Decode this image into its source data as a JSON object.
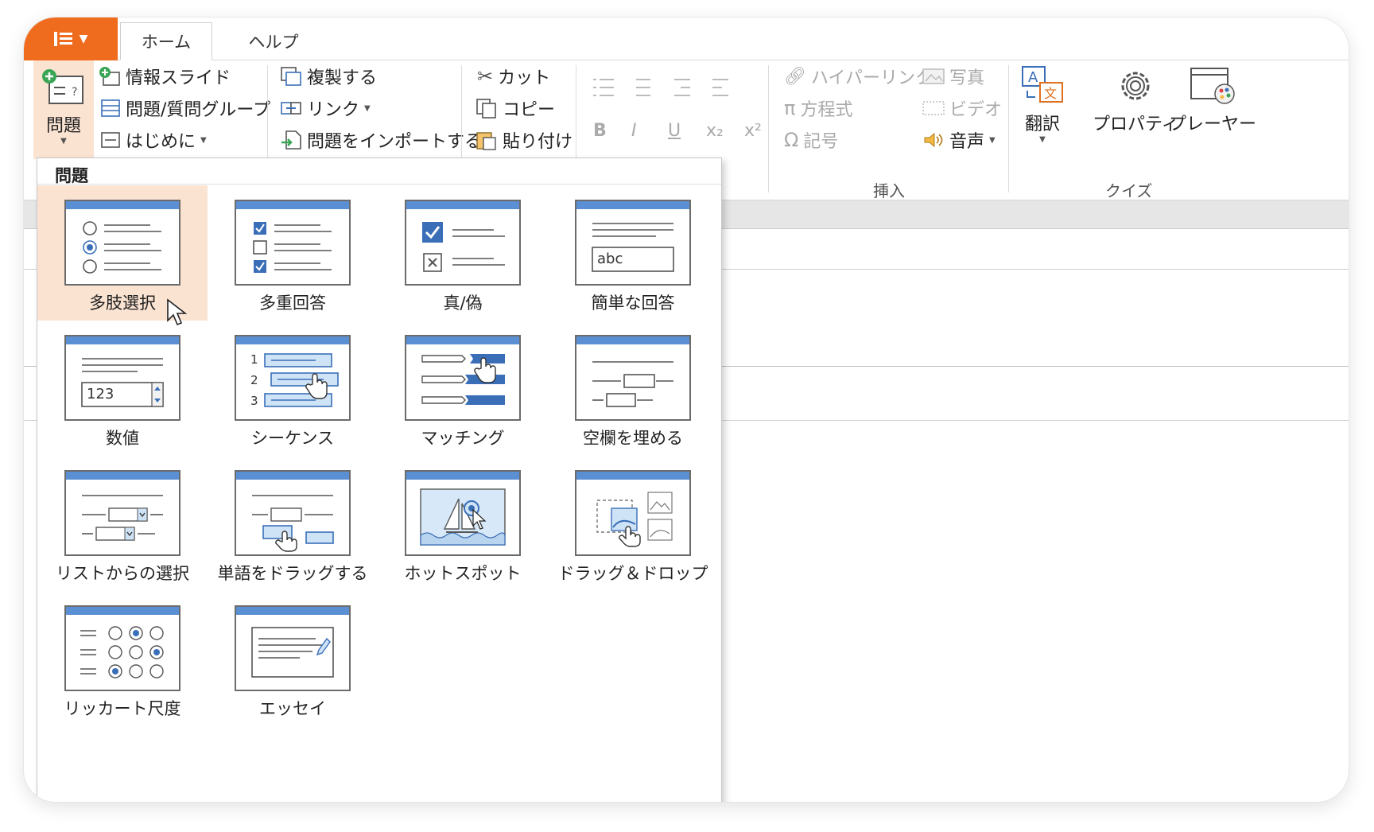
{
  "tabs": {
    "home": "ホーム",
    "help": "ヘルプ"
  },
  "ribbon": {
    "question_big": "問題",
    "info_slide": "情報スライド",
    "question_group": "問題/質問グループ",
    "intro": "はじめに",
    "duplicate": "複製する",
    "link": "リンク",
    "import_questions": "問題をインポートする",
    "cut": "カット",
    "copy": "コピー",
    "paste": "貼り付け",
    "bold": "B",
    "italic": "I",
    "underline": "U",
    "subscript": "x₂",
    "superscript": "x²",
    "hyperlink": "ハイパーリンク",
    "equation": "方程式",
    "symbol": "記号",
    "photo": "写真",
    "video": "ビデオ",
    "audio": "音声",
    "insert_group": "挿入",
    "translate": "翻訳",
    "properties": "プロパティ",
    "player": "プレーヤー",
    "quiz_group": "クイズ"
  },
  "dropdown": {
    "title": "問題",
    "items": [
      {
        "label": "多肢選択",
        "icon": "multiple-choice-icon",
        "selected": true
      },
      {
        "label": "多重回答",
        "icon": "multiple-response-icon"
      },
      {
        "label": "真/偽",
        "icon": "true-false-icon"
      },
      {
        "label": "簡単な回答",
        "icon": "short-answer-icon",
        "sample": "abc"
      },
      {
        "label": "数値",
        "icon": "numeric-icon",
        "sample": "123"
      },
      {
        "label": "シーケンス",
        "icon": "sequence-icon",
        "numbers": [
          "1",
          "2",
          "3"
        ]
      },
      {
        "label": "マッチング",
        "icon": "matching-icon"
      },
      {
        "label": "空欄を埋める",
        "icon": "fill-in-blank-icon"
      },
      {
        "label": "リストからの選択",
        "icon": "select-from-list-icon"
      },
      {
        "label": "単語をドラッグする",
        "icon": "drag-words-icon"
      },
      {
        "label": "ホットスポット",
        "icon": "hotspot-icon"
      },
      {
        "label": "ドラッグ＆ドロップ",
        "icon": "drag-and-drop-icon"
      },
      {
        "label": "リッカート尺度",
        "icon": "likert-scale-icon"
      },
      {
        "label": "エッセイ",
        "icon": "essay-icon"
      }
    ]
  }
}
